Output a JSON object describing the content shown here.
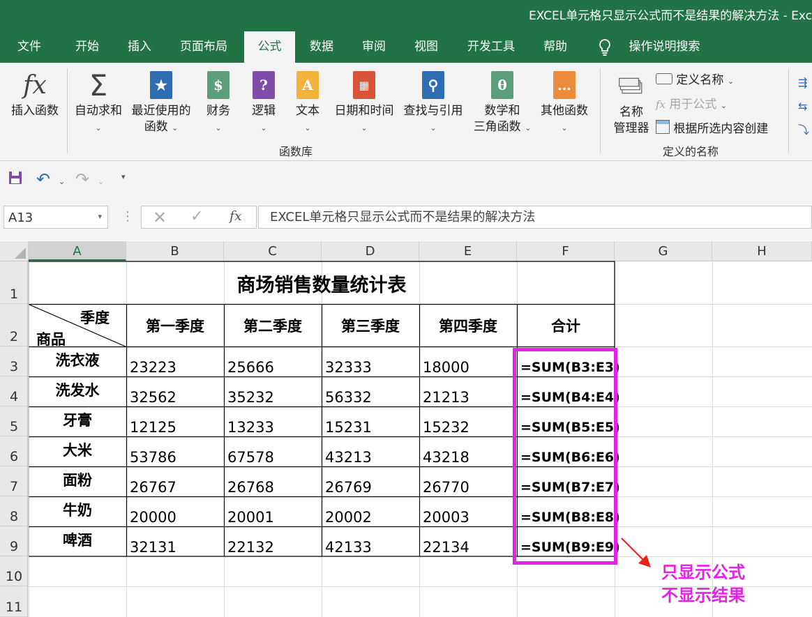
{
  "window": {
    "title": "EXCEL单元格只显示公式而不是结果的解决方法 - Exc"
  },
  "tabs": [
    "文件",
    "开始",
    "插入",
    "页面布局",
    "公式",
    "数据",
    "审阅",
    "视图",
    "开发工具",
    "帮助",
    "操作说明搜索"
  ],
  "ribbon": {
    "insert_function": "插入函数",
    "autosum": "自动求和",
    "recent_1": "最近使用的",
    "recent_2": "函数",
    "financial": "财务",
    "logical": "逻辑",
    "text": "文本",
    "datetime": "日期和时间",
    "lookup": "查找与引用",
    "math_1": "数学和",
    "math_2": "三角函数",
    "more": "其他函数",
    "group_library": "函数库",
    "name_manager_1": "名称",
    "name_manager_2": "管理器",
    "define_name": "定义名称",
    "use_in_formula": "用于公式",
    "create_from_selection": "根据所选内容创建",
    "group_defined_names": "定义的名称",
    "fx_symbol": "fx",
    "sum_symbol": "Σ"
  },
  "formula_bar": {
    "name_box": "A13",
    "content": "EXCEL单元格只显示公式而不是结果的解决方法",
    "fx": "fx"
  },
  "columns": [
    "A",
    "B",
    "C",
    "D",
    "E",
    "F",
    "G",
    "H"
  ],
  "rows": [
    "1",
    "2",
    "3",
    "4",
    "5",
    "6",
    "7",
    "8",
    "9",
    "10",
    "11"
  ],
  "sheet": {
    "title": "商场销售数量统计表",
    "corner_top": "季度",
    "corner_bottom": "商品",
    "headers": [
      "第一季度",
      "第二季度",
      "第三季度",
      "第四季度",
      "合计"
    ],
    "data": [
      [
        "洗衣液",
        "23223",
        "25666",
        "32333",
        "18000",
        "=SUM(B3:E3)"
      ],
      [
        "洗发水",
        "32562",
        "35232",
        "56332",
        "21213",
        "=SUM(B4:E4)"
      ],
      [
        "牙膏",
        "12125",
        "13233",
        "15231",
        "15232",
        "=SUM(B5:E5)"
      ],
      [
        "大米",
        "53786",
        "67578",
        "43213",
        "43218",
        "=SUM(B6:E6)"
      ],
      [
        "面粉",
        "26767",
        "26768",
        "26769",
        "26770",
        "=SUM(B7:E7)"
      ],
      [
        "牛奶",
        "20000",
        "20001",
        "20002",
        "20003",
        "=SUM(B8:E8)"
      ],
      [
        "啤酒",
        "32131",
        "22132",
        "42133",
        "22134",
        "=SUM(B9:E9)"
      ]
    ]
  },
  "annotation": {
    "line1": "只显示公式",
    "line2": "不显示结果"
  },
  "colors": {
    "excel_green": "#217346",
    "highlight": "#e620e6"
  }
}
